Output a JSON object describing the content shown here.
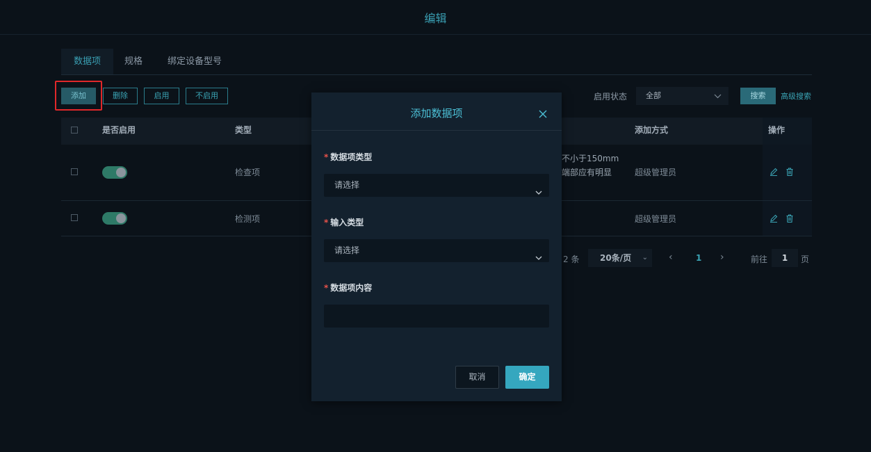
{
  "page": {
    "title": "编辑"
  },
  "tabs": [
    {
      "label": "数据项",
      "active": true
    },
    {
      "label": "规格",
      "active": false
    },
    {
      "label": "绑定设备型号",
      "active": false
    }
  ],
  "toolbar": {
    "add_label": "添加",
    "delete_label": "删除",
    "enable_label": "启用",
    "disable_label": "不启用",
    "status_label": "启用状态",
    "status_value": "全部",
    "search_label": "搜索",
    "advanced_search_label": "高级搜索"
  },
  "table": {
    "columns": [
      "是否启用",
      "类型",
      "添加方式",
      "操作"
    ],
    "rows": [
      {
        "enabled": true,
        "type": "检查项",
        "content_line1": "不小于150mm",
        "content_line2": "端部应有明显",
        "added_by": "超级管理员"
      },
      {
        "enabled": true,
        "type": "检测项",
        "content_line1": "",
        "content_line2": "",
        "added_by": "超级管理员"
      }
    ]
  },
  "pagination": {
    "total_text": "2 条",
    "page_size": "20条/页",
    "current_page": "1",
    "goto_label": "前往",
    "goto_value": "1",
    "page_suffix": "页"
  },
  "modal": {
    "title": "添加数据项",
    "fields": [
      {
        "label": "数据项类型",
        "placeholder": "请选择",
        "required": true
      },
      {
        "label": "输入类型",
        "placeholder": "请选择",
        "required": true
      },
      {
        "label": "数据项内容",
        "value": "",
        "required": true
      }
    ],
    "cancel_label": "取消",
    "confirm_label": "确定"
  },
  "colors": {
    "accent": "#35a7bf",
    "background": "#0b1219",
    "highlight_box": "#e0282a",
    "toggle_on": "#2e7a67"
  }
}
